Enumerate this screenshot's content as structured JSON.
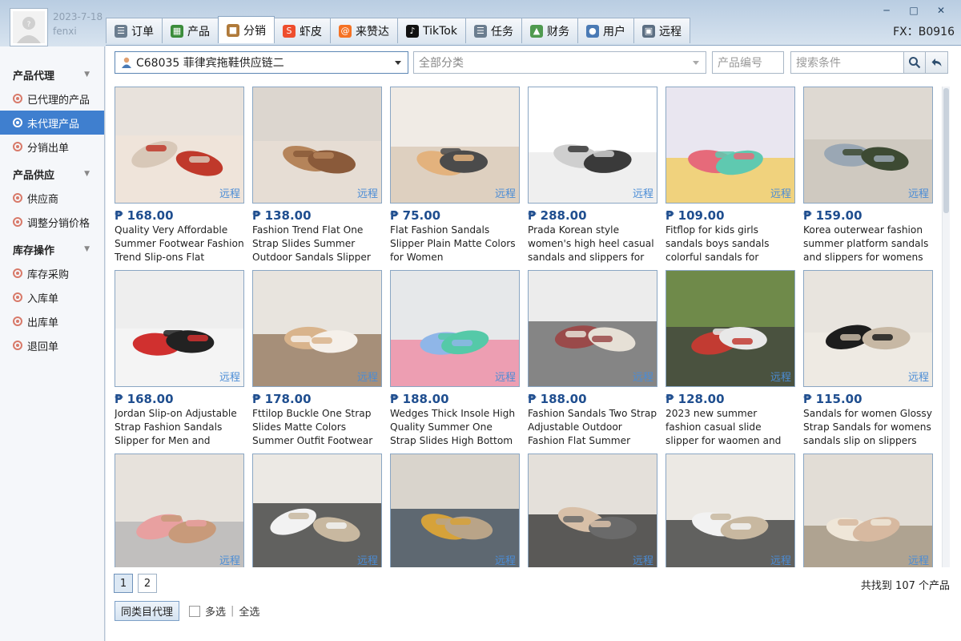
{
  "user": {
    "date": "2023-7-18",
    "name": "fenxi"
  },
  "region": "FX：B0916",
  "tabs": [
    {
      "label": "订单",
      "icon": "order-icon",
      "color": "#6b7d8f"
    },
    {
      "label": "产品",
      "icon": "grid-icon",
      "color": "#3a8c3a"
    },
    {
      "label": "分销",
      "icon": "box-icon",
      "color": "#b07a3a"
    },
    {
      "label": "虾皮",
      "icon": "shopee-icon",
      "color": "#ee4d2d"
    },
    {
      "label": "来赞达",
      "icon": "lazada-icon",
      "color": "#f57224"
    },
    {
      "label": "TikTok",
      "icon": "tiktok-icon",
      "color": "#111111"
    },
    {
      "label": "任务",
      "icon": "task-icon",
      "color": "#6b7d8f"
    },
    {
      "label": "财务",
      "icon": "finance-icon",
      "color": "#4f9a4f"
    },
    {
      "label": "用户",
      "icon": "user-icon",
      "color": "#4a7ab5"
    },
    {
      "label": "远程",
      "icon": "remote-icon",
      "color": "#5b6e82"
    }
  ],
  "active_tab": "分销",
  "sidebar": {
    "sections": [
      {
        "title": "产品代理",
        "items": [
          "已代理的产品",
          "未代理产品",
          "分销出单"
        ]
      },
      {
        "title": "产品供应",
        "items": [
          "供应商",
          "调整分销价格"
        ]
      },
      {
        "title": "库存操作",
        "items": [
          "库存采购",
          "入库单",
          "出库单",
          "退回单"
        ]
      }
    ],
    "active_item": "未代理产品"
  },
  "filters": {
    "supplier": "C68035 菲律宾拖鞋供应链二",
    "category": "全部分类",
    "product_code_placeholder": "产品编号",
    "search_placeholder": "搜索条件"
  },
  "remote_label": "远程",
  "products": [
    {
      "price": "₱ 168.00",
      "title": "Quality Very Affordable Summer Footwear Fashion Trend Slip-ons Flat"
    },
    {
      "price": "₱ 138.00",
      "title": "Fashion Trend Flat One Strap Slides Summer Outdoor Sandals Slipper"
    },
    {
      "price": "₱ 75.00",
      "title": "Flat Fashion Sandals Slipper Plain Matte Colors for Women"
    },
    {
      "price": "₱ 288.00",
      "title": "Prada Korean style women's high heel casual sandals and slippers for womens"
    },
    {
      "price": "₱ 109.00",
      "title": "Fitflop for kids girls sandals boys sandals colorful sandals for children"
    },
    {
      "price": "₱ 159.00",
      "title": "Korea outerwear fashion summer platform sandals and slippers for womens"
    },
    {
      "price": "₱ 168.00",
      "title": "Jordan Slip-on Adjustable Strap Fashion Sandals Slipper for Men and"
    },
    {
      "price": "₱ 178.00",
      "title": "Fttilop Buckle One Strap Slides Matte Colors Summer Outfit Footwear"
    },
    {
      "price": "₱ 188.00",
      "title": "Wedges Thick Insole High Quality Summer One Strap Slides High Bottom"
    },
    {
      "price": "₱ 188.00",
      "title": "Fashion Sandals Two Strap Adjustable Outdoor Fashion Flat Summer"
    },
    {
      "price": "₱ 128.00",
      "title": "2023 new summer fashion casual slide slipper for waomen and men unisex"
    },
    {
      "price": "₱ 115.00",
      "title": "Sandals for women Glossy Strap Sandals for womens sandals slip on slippers"
    },
    {
      "price": "",
      "title": ""
    },
    {
      "price": "",
      "title": ""
    },
    {
      "price": "",
      "title": ""
    },
    {
      "price": "",
      "title": ""
    },
    {
      "price": "",
      "title": ""
    },
    {
      "price": "",
      "title": ""
    }
  ],
  "pagination": {
    "pages": [
      "1",
      "2"
    ],
    "current": "1"
  },
  "result_count": "共找到 107 个产品",
  "actions": {
    "proxy_button": "同类目代理",
    "multi_select": "多选",
    "separator": "|",
    "select_all": "全选"
  }
}
